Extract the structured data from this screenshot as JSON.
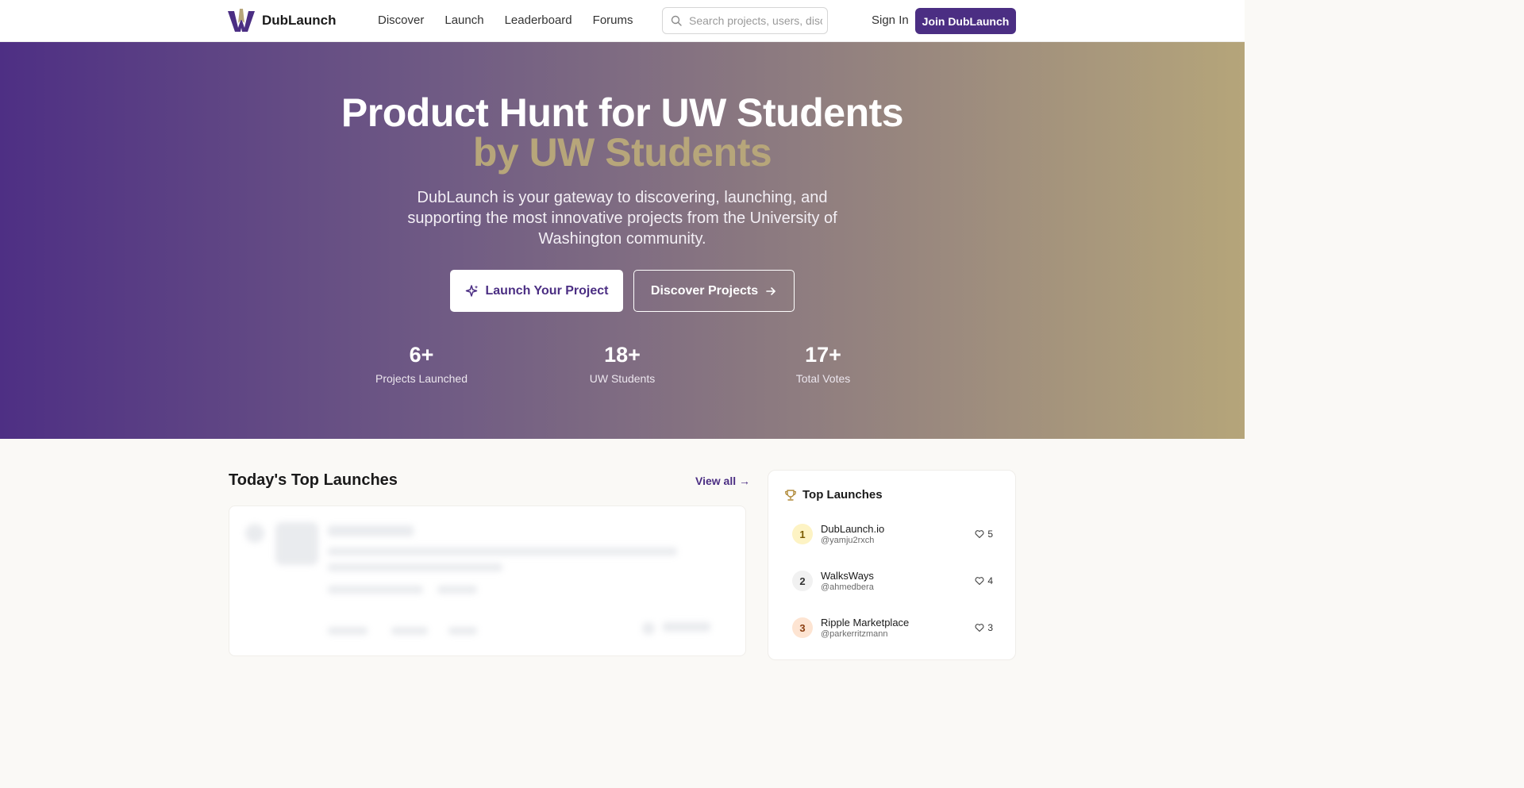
{
  "brand": {
    "name": "DubLaunch",
    "accent": "#4b2e83",
    "gold": "#b7a67a"
  },
  "nav": {
    "links": [
      {
        "label": "Discover"
      },
      {
        "label": "Launch"
      },
      {
        "label": "Leaderboard"
      },
      {
        "label": "Forums"
      }
    ],
    "search_placeholder": "Search projects, users, discussions",
    "sign_in": "Sign In",
    "join": "Join DubLaunch"
  },
  "hero": {
    "title_line1": "Product Hunt for UW Students",
    "title_line2": "by UW Students",
    "subtitle": "DubLaunch is your gateway to discovering, launching, and supporting the most innovative projects from the University of Washington community.",
    "primary_cta": "Launch Your Project",
    "secondary_cta": "Discover Projects",
    "stats": [
      {
        "value": "6+",
        "label": "Projects Launched"
      },
      {
        "value": "18+",
        "label": "UW Students"
      },
      {
        "value": "17+",
        "label": "Total Votes"
      }
    ]
  },
  "main": {
    "section_title": "Today's Top Launches",
    "view_all": "View all →"
  },
  "sidebar": {
    "title": "Top Launches",
    "items": [
      {
        "rank": "1",
        "name": "DubLaunch.io",
        "user": "@yamju2rxch",
        "votes": "5",
        "badge_bg": "#fdf3c4",
        "badge_fg": "#7a5a00"
      },
      {
        "rank": "2",
        "name": "WalksWays",
        "user": "@ahmedbera",
        "votes": "4",
        "badge_bg": "#f1f1f1",
        "badge_fg": "#333333"
      },
      {
        "rank": "3",
        "name": "Ripple Marketplace",
        "user": "@parkerritzmann",
        "votes": "3",
        "badge_bg": "#fde4d2",
        "badge_fg": "#8a3d10"
      }
    ]
  }
}
